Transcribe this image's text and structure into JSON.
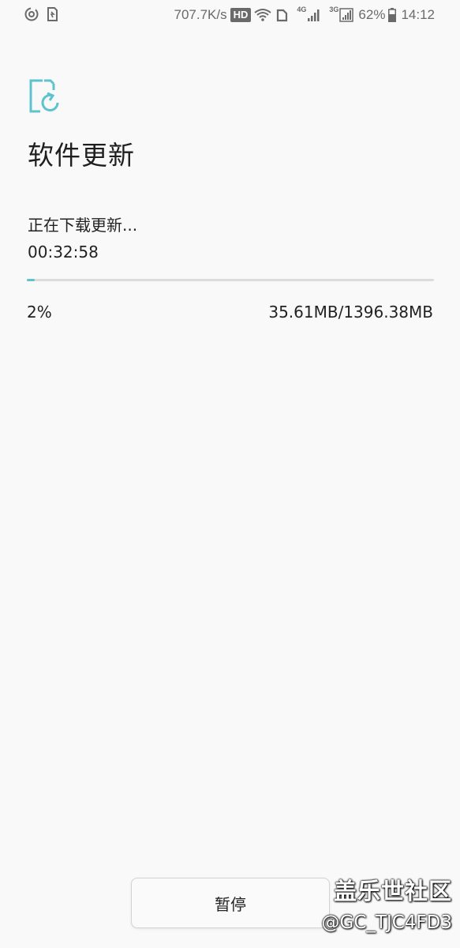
{
  "status_bar": {
    "left_icons": [
      "sync-icon",
      "sim-card-icon"
    ],
    "net_speed": "707.7K/s",
    "hd_badge": "HD",
    "network_1": "4G",
    "network_2": "3G",
    "battery_percent": "62%",
    "time": "14:12",
    "right_icons": [
      "wifi-icon",
      "sd-card-icon",
      "signal-icon",
      "battery-icon"
    ]
  },
  "header": {
    "icon": "software-update-icon",
    "title": "软件更新"
  },
  "download": {
    "status_text": "正在下载更新...",
    "elapsed_time": "00:32:58",
    "progress_percent": 2,
    "percent_label": "2%",
    "size_label": "35.61MB/1396.38MB"
  },
  "actions": {
    "pause_label": "暂停"
  },
  "watermark": {
    "main": "盖乐世社区",
    "sub": "@GC_TJC4FD3"
  },
  "colors": {
    "accent": "#5fc2cf",
    "background": "#f9f9f9",
    "text": "#222222",
    "status_text": "#6a6a6a"
  }
}
